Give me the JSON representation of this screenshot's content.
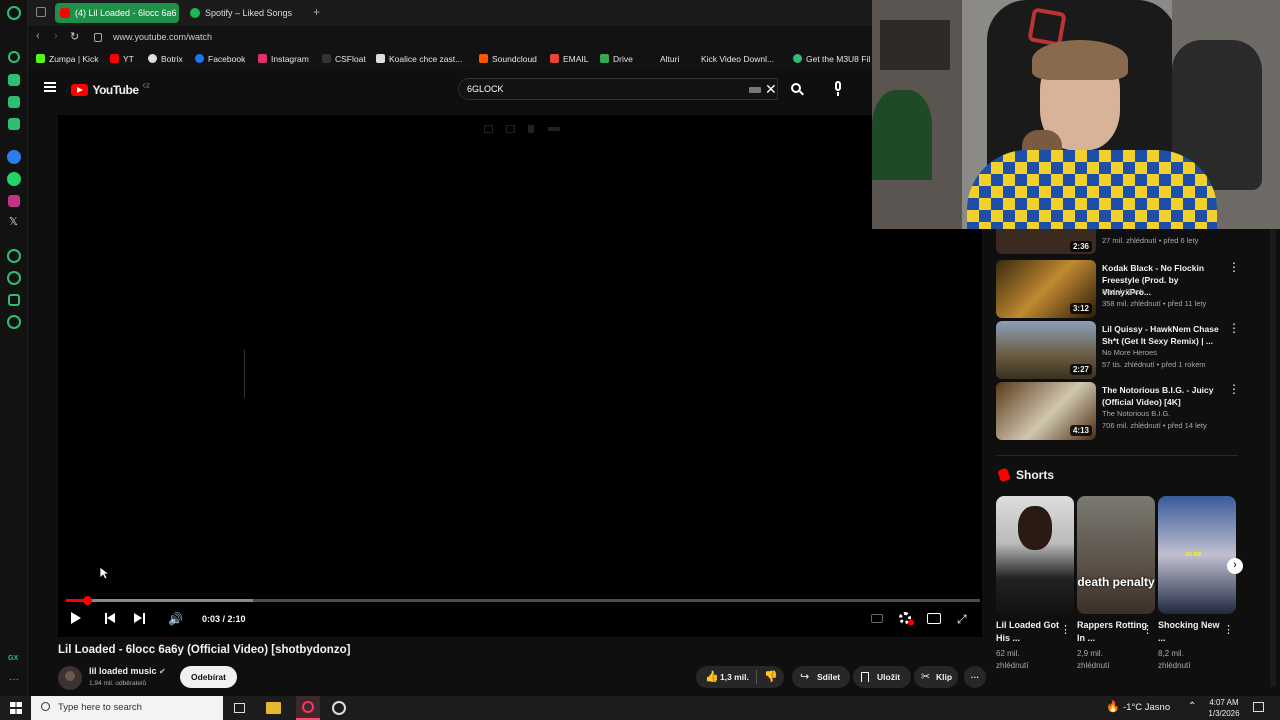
{
  "browser": {
    "tabs": [
      {
        "label": "(4) Lil Loaded - 6locc 6a6",
        "active": true
      },
      {
        "label": "Spotify – Liked Songs",
        "active": false
      }
    ],
    "url": "www.youtube.com/watch",
    "bookmarks": [
      "Zumpa | Kick",
      "YT",
      "Botrix",
      "Facebook",
      "Instagram",
      "CSFloat",
      "Koalice chce zast...",
      "Soundcloud",
      "EMAIL",
      "Drive",
      "Alturi",
      "Kick Video Downl...",
      "Get the M3U8 Fil"
    ],
    "sidebar_bottom_label": "GX"
  },
  "youtube": {
    "logo_text": "YouTube",
    "logo_region": "CZ",
    "search_query": "6GLOCK"
  },
  "player": {
    "time_current": "0:03",
    "time_total": "2:10",
    "time_display": "0:03 / 2:10",
    "progress_fraction": 0.023,
    "buffer_fraction": 0.205
  },
  "video": {
    "title": "Lil Loaded - 6locc 6a6y (Official Video) [shotbydonzo]",
    "channel": "lil loaded music",
    "subscribers": "1,94 mil. odběratelů",
    "subscribe_label": "Odebírat",
    "likes": "1,3 mil.",
    "share_label": "Sdílet",
    "save_label": "Uložit",
    "clip_label": "Klip"
  },
  "related": [
    {
      "title": "",
      "channel": "",
      "meta": "27 mil. zhlédnutí • před 6 lety",
      "duration": "2:36"
    },
    {
      "title": "Kodak Black - No Flockin Freestyle (Prod. by VinnyxPro...",
      "channel": "Kodak Black",
      "meta": "358 mil. zhlédnutí • před 11 lety",
      "duration": "3:12"
    },
    {
      "title": "Lil Quissy - HawkNem Chase Sh*t (Get It Sexy Remix) | ...",
      "channel": "No More Heroes",
      "meta": "57 tis. zhlédnutí • před 1 rokem",
      "duration": "2:27"
    },
    {
      "title": "The Notorious B.I.G. - Juicy (Official Video) [4K]",
      "channel": "The Notorious B.I.G.",
      "meta": "706 mil. zhlédnutí • před 14 lety",
      "duration": "4:13"
    }
  ],
  "shorts": {
    "heading": "Shorts",
    "items": [
      {
        "title": "Lil Loaded Got His ...",
        "views": "62 mil.",
        "views_label": "zhlédnutí",
        "overlay": ""
      },
      {
        "title": "Rappers Rotting In ...",
        "views": "2,9 mil.",
        "views_label": "zhlédnutí",
        "overlay": "death penalty"
      },
      {
        "title": "Shocking New ...",
        "views": "8,2 mil.",
        "views_label": "zhlédnutí",
        "overlay": "to be"
      }
    ]
  },
  "taskbar": {
    "search_placeholder": "Type here to search",
    "weather": "-1°C  Jasno",
    "time": "4:07 AM",
    "date": "1/3/2026"
  },
  "colors": {
    "accent": "#ff0000",
    "gx_green": "#2fbf71",
    "tab_active": "#1f8f4a"
  }
}
